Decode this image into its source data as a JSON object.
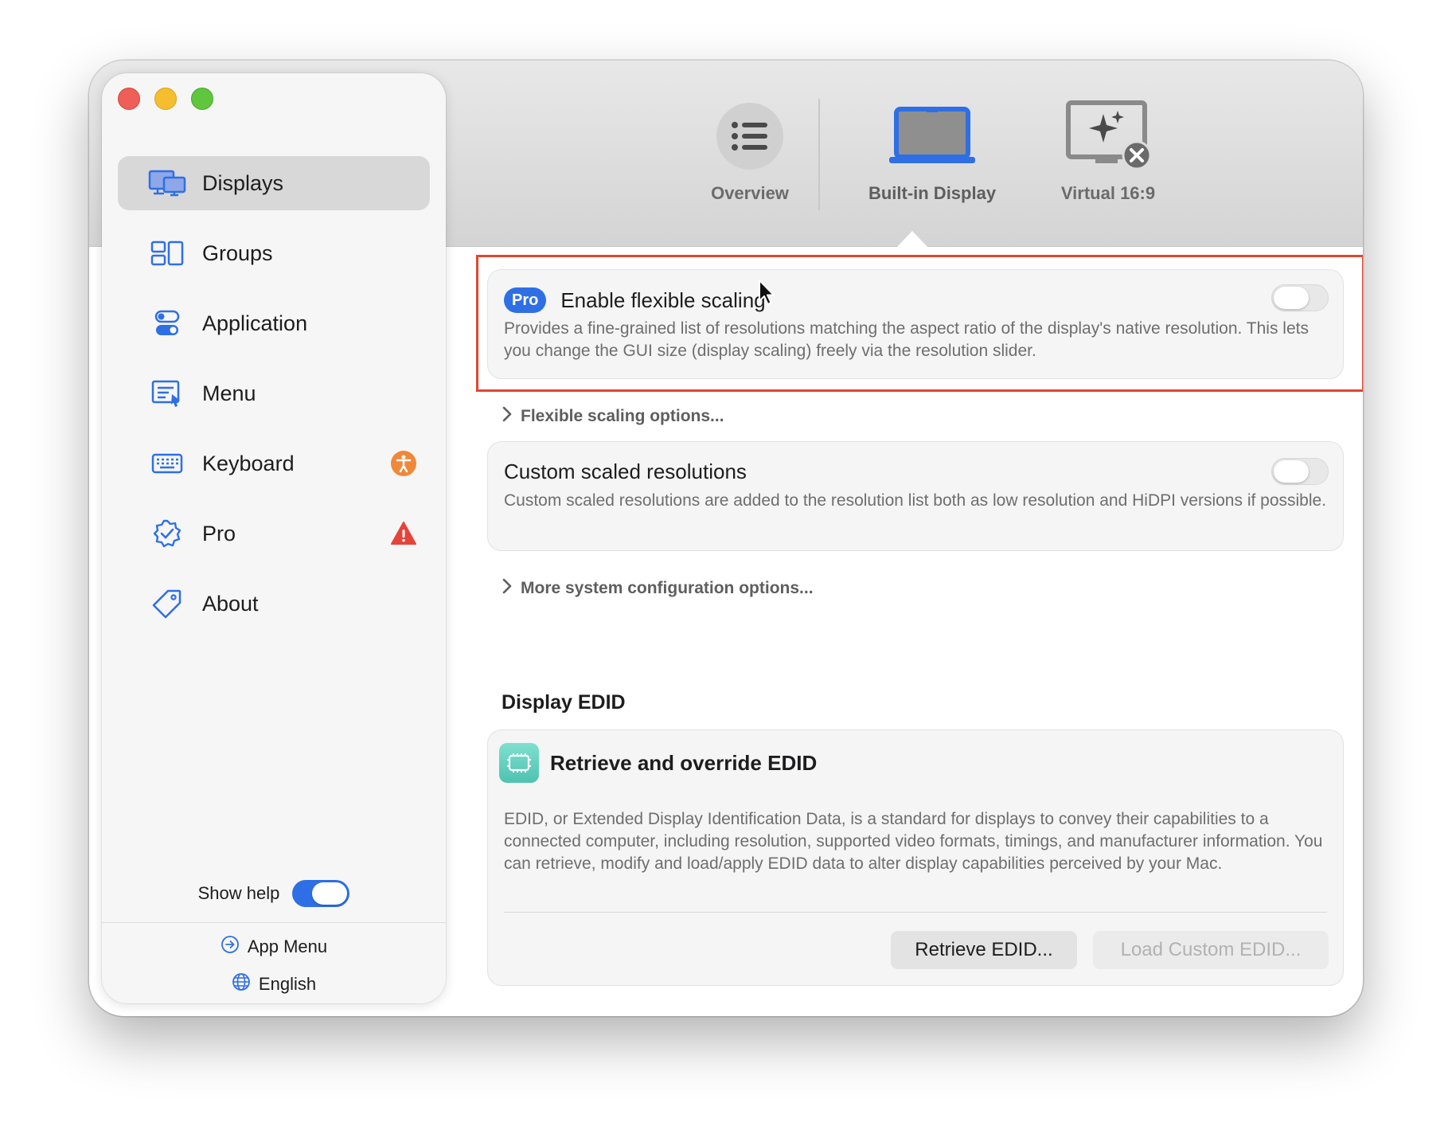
{
  "colors": {
    "accent": "#2f6fe6",
    "highlight_border": "#e1472f",
    "badge_orange": "#f0883a",
    "badge_red": "#e5443b"
  },
  "sidebar": {
    "items": [
      {
        "label": "Displays",
        "icon": "displays-icon",
        "active": true
      },
      {
        "label": "Groups",
        "icon": "groups-icon"
      },
      {
        "label": "Application",
        "icon": "application-toggles-icon"
      },
      {
        "label": "Menu",
        "icon": "menu-icon"
      },
      {
        "label": "Keyboard",
        "icon": "keyboard-icon",
        "badge": "accessibility-badge-icon"
      },
      {
        "label": "Pro",
        "icon": "pro-seal-icon",
        "badge": "warning-triangle-icon"
      },
      {
        "label": "About",
        "icon": "tag-icon"
      }
    ],
    "show_help_label": "Show help",
    "show_help_on": true,
    "app_menu_label": "App Menu",
    "language_label": "English"
  },
  "tabs": [
    {
      "label": "Overview",
      "icon": "list-icon"
    },
    {
      "label": "Built-in Display",
      "icon": "laptop-icon",
      "active": true
    },
    {
      "label": "Virtual 16:9",
      "icon": "virtual-display-icon"
    }
  ],
  "flexible_scaling": {
    "pro_badge": "Pro",
    "title": "Enable flexible scaling",
    "description": "Provides a fine-grained list of resolutions matching the aspect ratio of the display's native resolution. This lets you change the GUI size (display scaling) freely via the resolution slider.",
    "enabled": false
  },
  "flexible_options_label": "Flexible scaling options...",
  "custom_resolutions": {
    "title": "Custom scaled resolutions",
    "description": "Custom scaled resolutions are added to the resolution list both as low resolution and HiDPI versions if possible.",
    "enabled": false
  },
  "more_options_label": "More system configuration options...",
  "edid_section_title": "Display EDID",
  "edid": {
    "title": "Retrieve and override EDID",
    "description": "EDID, or Extended Display Identification Data, is a standard for displays to convey their capabilities to a connected computer, including resolution, supported video formats, timings, and manufacturer information. You can retrieve, modify and load/apply EDID data to alter display capabilities perceived by your Mac.",
    "retrieve_button": "Retrieve EDID...",
    "load_button": "Load Custom EDID..."
  }
}
